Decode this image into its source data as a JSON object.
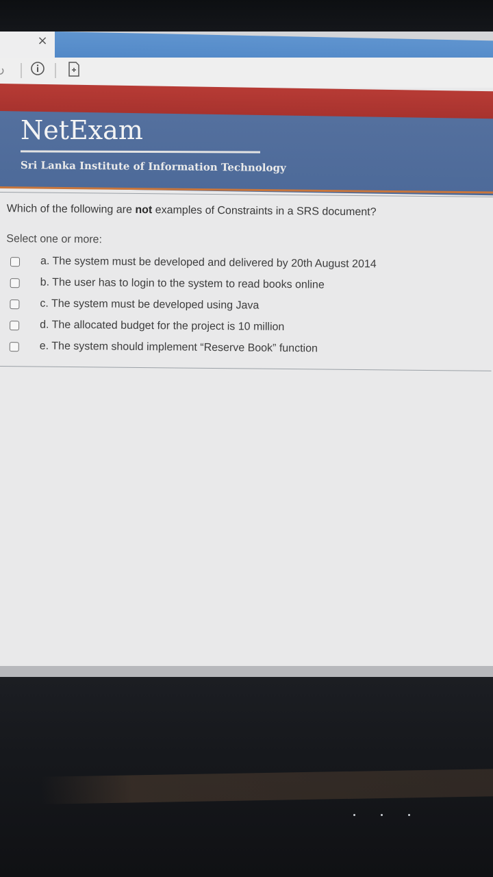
{
  "browser": {
    "tab_close_glyph": "×"
  },
  "header": {
    "logo_text": "NetExam",
    "institute": "Sri Lanka Institute of Information Technology"
  },
  "quiz": {
    "question_pre": "Which of the following are ",
    "question_bold": "not",
    "question_post": " examples of Constraints in a SRS document?",
    "select_hint": "Select one or more:",
    "options": [
      {
        "label": "a. The system must be developed and delivered by 20th August 2014",
        "checked": false
      },
      {
        "label": "b. The user has to login to the system to read books online",
        "checked": false
      },
      {
        "label": "c. The system must be developed using Java",
        "checked": false
      },
      {
        "label": "d. The allocated budget for the project is 10 million",
        "checked": false
      },
      {
        "label": "e. The system should implement “Reserve Book” function",
        "checked": false
      }
    ]
  },
  "colors": {
    "header_blue": "#54709e",
    "header_red": "#b73b35",
    "accent_orange": "#c9763c",
    "tab_blue": "#5f94cf"
  }
}
